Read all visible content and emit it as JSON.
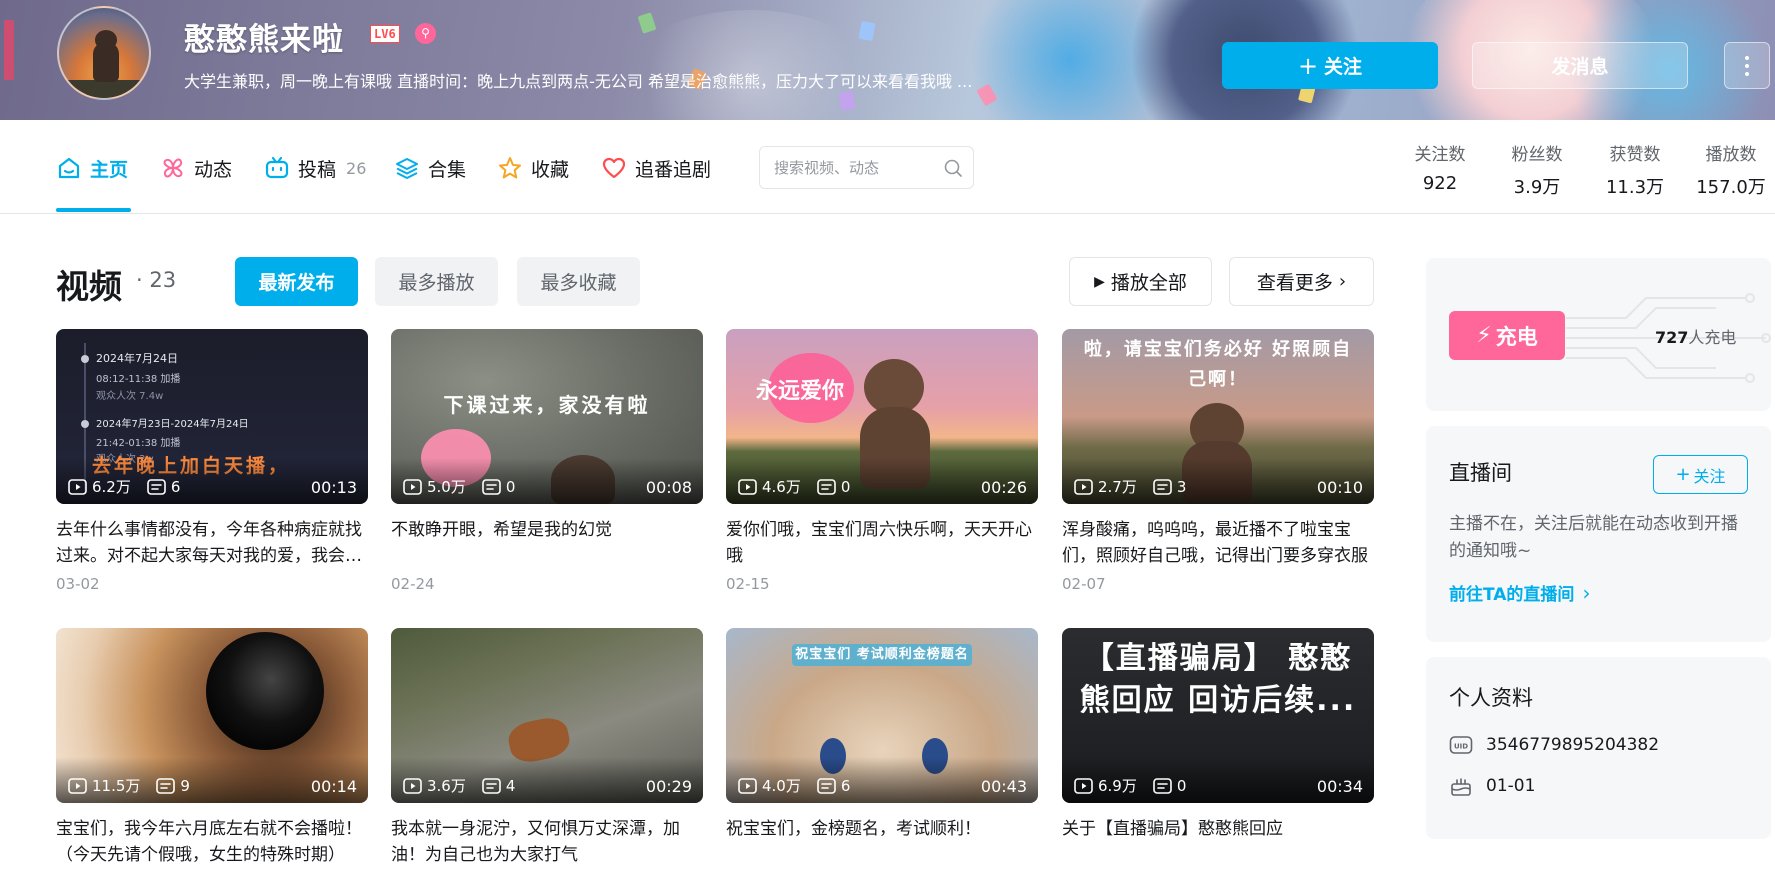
{
  "profile": {
    "name": "憨憨熊来啦",
    "level": "LV6",
    "badge_glyph": "⚲",
    "sign": "大学生兼职，周一晚上有课哦 直播时间：晚上九点到两点-无公司 希望是治愈熊熊，压力大了可以来看看我哦 ...",
    "follow_label": "关注",
    "message_label": "发消息"
  },
  "nav": {
    "tabs": [
      {
        "label": "主页",
        "icon": "home-icon",
        "count": ""
      },
      {
        "label": "动态",
        "icon": "pinwheel-icon",
        "count": ""
      },
      {
        "label": "投稿",
        "icon": "tv-icon",
        "count": "26"
      },
      {
        "label": "合集",
        "icon": "layers-icon",
        "count": ""
      },
      {
        "label": "收藏",
        "icon": "star-icon",
        "count": ""
      },
      {
        "label": "追番追剧",
        "icon": "heart-icon",
        "count": ""
      }
    ],
    "search_placeholder": "搜索视频、动态"
  },
  "stats": [
    {
      "label": "关注数",
      "value": "922"
    },
    {
      "label": "粉丝数",
      "value": "3.9万"
    },
    {
      "label": "获赞数",
      "value": "11.3万"
    },
    {
      "label": "播放数",
      "value": "157.0万"
    }
  ],
  "videos_section": {
    "title": "视频",
    "count": "· 23",
    "filters": [
      "最新发布",
      "最多播放",
      "最多收藏"
    ],
    "play_all": "播放全部",
    "see_more": "查看更多"
  },
  "videos": [
    {
      "title": "去年什么事情都没有，今年各种病症就找过来。对不起大家每天对我的爱，我会努力的！",
      "date": "03-02",
      "views": "6.2万",
      "comments": "6",
      "duration": "00:13",
      "caption": "去年晚上加白天播，"
    },
    {
      "title": "不敢睁开眼，希望是我的幻觉",
      "date": "02-24",
      "views": "5.0万",
      "comments": "0",
      "duration": "00:08",
      "caption": "下课过来，家没有啦"
    },
    {
      "title": "爱你们哦，宝宝们周六快乐啊，天天开心哦",
      "date": "02-15",
      "views": "4.6万",
      "comments": "0",
      "duration": "00:26",
      "caption": "永远爱你"
    },
    {
      "title": "浑身酸痛，呜呜呜，最近播不了啦宝宝们，照顾好自己哦，记得出门要多穿衣服",
      "date": "02-07",
      "views": "2.7万",
      "comments": "3",
      "duration": "00:10",
      "caption": "啦，请宝宝们务必好 好照顾自己啊！"
    },
    {
      "title": "宝宝们，我今年六月底左右就不会播啦！（今天先请个假哦，女生的特殊时期）",
      "date": "",
      "views": "11.5万",
      "comments": "9",
      "duration": "00:14",
      "caption": ""
    },
    {
      "title": "我本就一身泥泞，又何惧万丈深潭，加油！为自己也为大家打气",
      "date": "",
      "views": "3.6万",
      "comments": "4",
      "duration": "00:29",
      "caption": ""
    },
    {
      "title": "祝宝宝们，金榜题名，考试顺利！",
      "date": "",
      "views": "4.0万",
      "comments": "6",
      "duration": "00:43",
      "caption": "祝宝宝们 考试顺利金榜题名"
    },
    {
      "title": "关于【直播骗局】憨憨熊回应",
      "date": "",
      "views": "6.9万",
      "comments": "0",
      "duration": "00:34",
      "caption": "【直播骗局】 憨憨熊回应 回访后续..."
    }
  ],
  "thumb_text": {
    "t0_l1": "2024年7月24日",
    "t0_l2": "08:12-11:38 加播",
    "t0_l3": "观众人次 7.4w",
    "t0_l4": "2024年7月23日-2024年7月24日",
    "t0_l5": "21:42-01:38 加播",
    "t0_l6": "观众人次 2w"
  },
  "sidebar": {
    "charge_label": "充电",
    "charge_count": "727",
    "charge_suffix": "人充电",
    "live_title": "直播间",
    "live_follow": "关注",
    "live_desc": "主播不在，关注后就能在动态收到开播的通知哦~",
    "live_link": "前往TA的直播间",
    "profile_title": "个人资料",
    "uid": "3546779895204382",
    "birthday": "01-01"
  },
  "colors": {
    "accent": "#00aeec",
    "pink": "#ff6699",
    "text_secondary": "#61666d"
  }
}
